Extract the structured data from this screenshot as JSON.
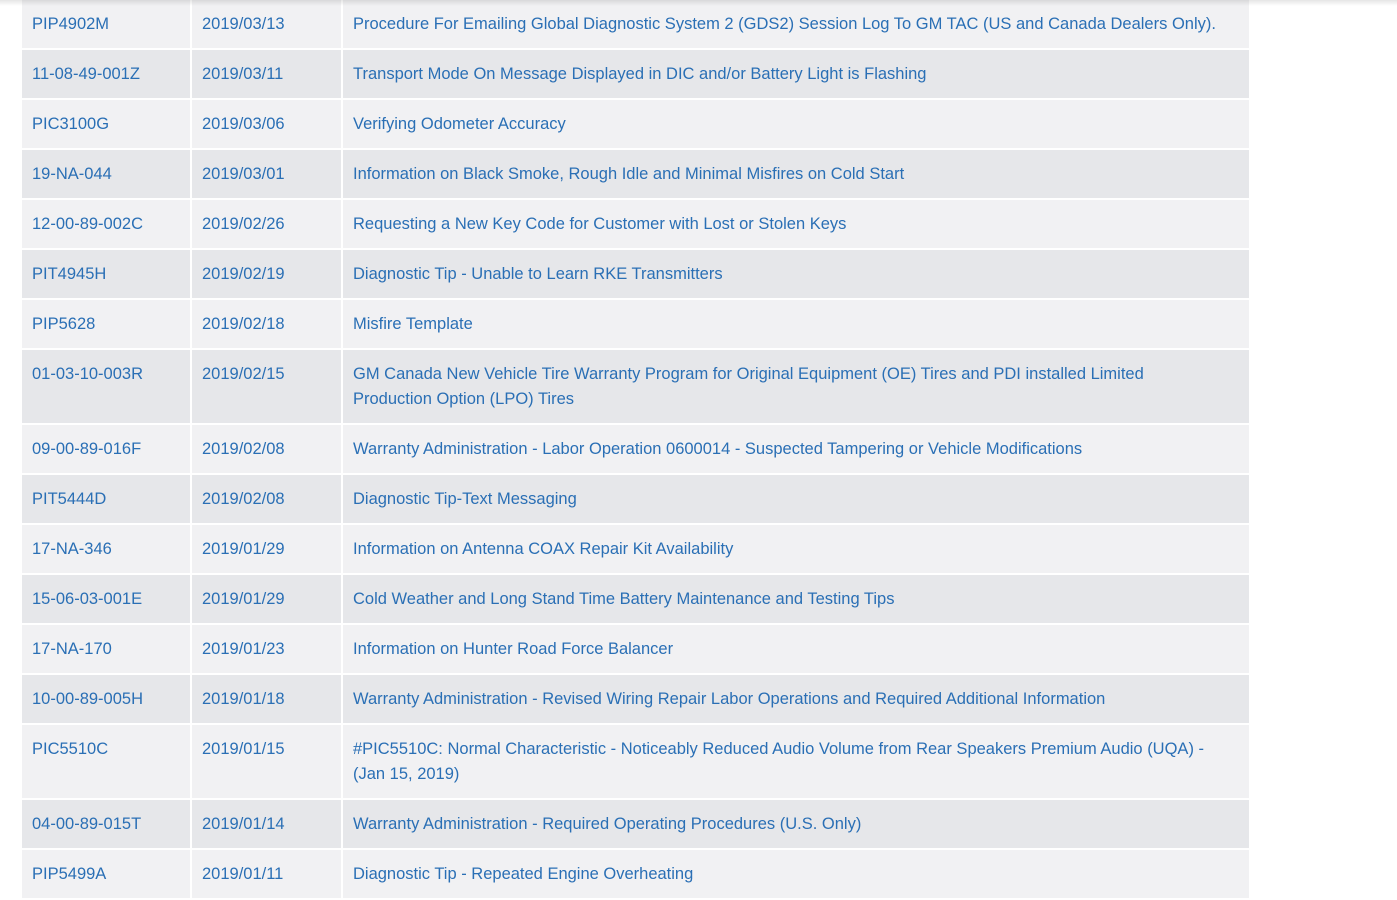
{
  "bulletins": [
    {
      "id": "PIP4902M",
      "date": "2019/03/13",
      "title": "Procedure For Emailing Global Diagnostic System 2 (GDS2) Session Log To GM TAC (US and Canada Dealers Only)."
    },
    {
      "id": "11-08-49-001Z",
      "date": "2019/03/11",
      "title": "Transport Mode On Message Displayed in DIC and/or Battery Light is Flashing"
    },
    {
      "id": "PIC3100G",
      "date": "2019/03/06",
      "title": "Verifying Odometer Accuracy"
    },
    {
      "id": "19-NA-044",
      "date": "2019/03/01",
      "title": "Information on Black Smoke, Rough Idle and Minimal Misfires on Cold Start"
    },
    {
      "id": "12-00-89-002C",
      "date": "2019/02/26",
      "title": "Requesting a New Key Code for Customer with Lost or Stolen Keys"
    },
    {
      "id": "PIT4945H",
      "date": "2019/02/19",
      "title": "Diagnostic Tip - Unable to Learn RKE Transmitters"
    },
    {
      "id": "PIP5628",
      "date": "2019/02/18",
      "title": "Misfire Template"
    },
    {
      "id": "01-03-10-003R",
      "date": "2019/02/15",
      "title": "GM Canada New Vehicle Tire Warranty Program for Original Equipment (OE) Tires and PDI installed Limited Production Option (LPO) Tires"
    },
    {
      "id": "09-00-89-016F",
      "date": "2019/02/08",
      "title": "Warranty Administration - Labor Operation 0600014 - Suspected Tampering or Vehicle Modifications"
    },
    {
      "id": "PIT5444D",
      "date": "2019/02/08",
      "title": "Diagnostic Tip-Text Messaging"
    },
    {
      "id": "17-NA-346",
      "date": "2019/01/29",
      "title": "Information on Antenna COAX Repair Kit Availability"
    },
    {
      "id": "15-06-03-001E",
      "date": "2019/01/29",
      "title": "Cold Weather and Long Stand Time Battery Maintenance and Testing Tips"
    },
    {
      "id": "17-NA-170",
      "date": "2019/01/23",
      "title": "Information on Hunter Road Force Balancer"
    },
    {
      "id": "10-00-89-005H",
      "date": "2019/01/18",
      "title": "Warranty Administration - Revised Wiring Repair Labor Operations and Required Additional Information"
    },
    {
      "id": "PIC5510C",
      "date": "2019/01/15",
      "title": "#PIC5510C: Normal Characteristic - Noticeably Reduced Audio Volume from Rear Speakers Premium Audio (UQA) - (Jan 15, 2019)"
    },
    {
      "id": "04-00-89-015T",
      "date": "2019/01/14",
      "title": "Warranty Administration - Required Operating Procedures (U.S. Only)"
    },
    {
      "id": "PIP5499A",
      "date": "2019/01/11",
      "title": "Diagnostic Tip - Repeated Engine Overheating"
    }
  ]
}
